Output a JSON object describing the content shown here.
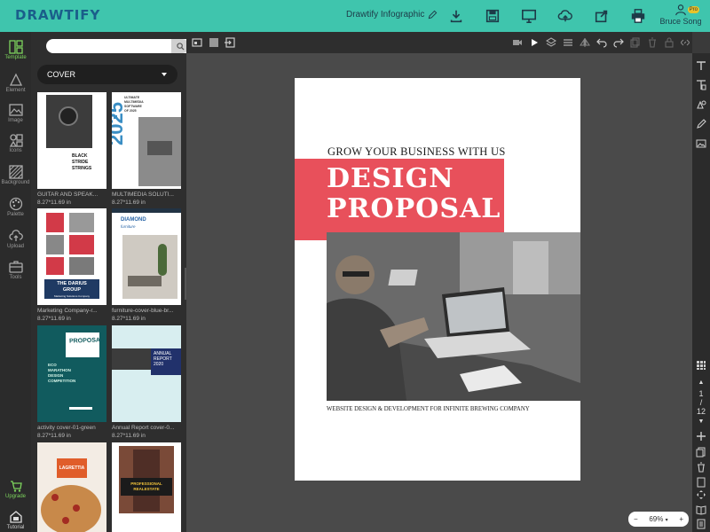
{
  "app": {
    "logo_text": "DRAWTIFY",
    "document_title": "Drawtify Infographic",
    "user_name": "Bruce Song",
    "pro_badge": "Pro",
    "brand_color": "#3fc5ad"
  },
  "toolbar": {
    "icons": [
      "download-icon",
      "save-icon",
      "present-icon",
      "cloud-upload-icon",
      "share-icon",
      "print-icon"
    ]
  },
  "rail": {
    "items": [
      {
        "label": "Template",
        "icon": "template-icon"
      },
      {
        "label": "Element",
        "icon": "element-icon"
      },
      {
        "label": "Image",
        "icon": "image-icon"
      },
      {
        "label": "Icons",
        "icon": "icons-icon"
      },
      {
        "label": "Background",
        "icon": "background-icon"
      },
      {
        "label": "Palette",
        "icon": "palette-icon"
      },
      {
        "label": "Upload",
        "icon": "upload-icon"
      },
      {
        "label": "Tools",
        "icon": "tools-icon"
      },
      {
        "label": "Upgrade",
        "icon": "upgrade-icon"
      },
      {
        "label": "Tutorial",
        "icon": "tutorial-icon"
      }
    ]
  },
  "panel": {
    "search_placeholder": "",
    "category": "COVER",
    "templates": [
      {
        "name": "GUITAR AND SPEAK...",
        "size": "8.27*11.69 in",
        "thumb_text": [
          "BLACK",
          "STRIDE",
          "STRINGS"
        ]
      },
      {
        "name": "MULTIMEDIA SOLUTI...",
        "size": "8.27*11.69 in",
        "thumb_text": [
          "ULTIMATE",
          "MULTIMEDIA",
          "SOFTWARE",
          "OF 2025",
          "2025"
        ]
      },
      {
        "name": "Marketing Company-r...",
        "size": "8.27*11.69 in",
        "thumb_text": [
          "THE DARIUS",
          "GROUP",
          "Marketing Solutions Company"
        ]
      },
      {
        "name": "furniture-cover-blue-br...",
        "size": "8.27*11.69 in",
        "thumb_text": [
          "DIAMOND",
          "furniture"
        ]
      },
      {
        "name": "activity cover-01-green",
        "size": "8.27*11.69 in",
        "thumb_text": [
          "PROPOSAL",
          "ECO",
          "MARATHON",
          "DESIGN",
          "COMPETITION"
        ]
      },
      {
        "name": "Annual Report cover-0...",
        "size": "8.27*11.69 in",
        "thumb_text": [
          "ANNUAL",
          "REPORT",
          "2020"
        ]
      },
      {
        "name": "",
        "size": "",
        "thumb_text": [
          "LAGRETTIA"
        ]
      },
      {
        "name": "",
        "size": "",
        "thumb_text": [
          "PROFESSIONAL",
          "REALESTATE"
        ]
      }
    ]
  },
  "page": {
    "heading": "GROW YOUR BUSINESS WITH US",
    "title_line1": "DESIGN",
    "title_line2": "PROPOSAL",
    "subtitle": "WEBSITE DESIGN & DEVELOPMENT FOR INFINITE BREWING COMPANY",
    "accent_color": "#e8505b"
  },
  "pager": {
    "current": "1",
    "separator": "/",
    "total": "12"
  },
  "zoom": {
    "minus": "−",
    "value": "69%",
    "plus": "+"
  }
}
